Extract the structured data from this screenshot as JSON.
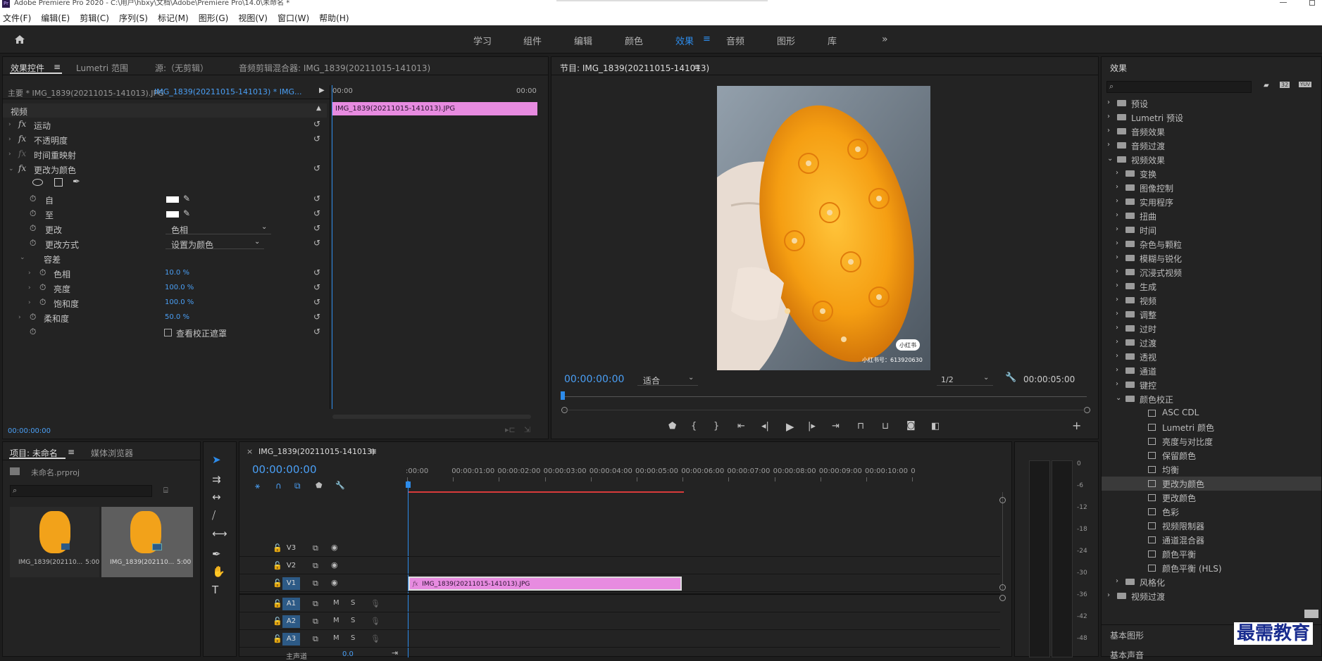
{
  "window": {
    "title": "Adobe Premiere Pro 2020 - C:\\用户\\hbxy\\文档\\Adobe\\Premiere Pro\\14.0\\未命名 *",
    "app_badge": "Pr"
  },
  "menu": [
    "文件(F)",
    "编辑(E)",
    "剪辑(C)",
    "序列(S)",
    "标记(M)",
    "图形(G)",
    "视图(V)",
    "窗口(W)",
    "帮助(H)"
  ],
  "workspaces": {
    "home_icon": "home-icon",
    "items": [
      "学习",
      "组件",
      "编辑",
      "颜色",
      "效果",
      "音频",
      "图形",
      "库"
    ],
    "active": "效果",
    "more": "»"
  },
  "effect_controls": {
    "tabs": [
      "效果控件",
      "Lumetri 范围",
      "源:（无剪辑）",
      "音频剪辑混合器: IMG_1839(20211015-141013)"
    ],
    "master": "主要 * IMG_1839(20211015-141013).JPG",
    "clip_ref": "IMG_1839(20211015-141013) * IMG...",
    "section": "视频",
    "effects": [
      "运动",
      "不透明度",
      "时间重映射",
      "更改为颜色"
    ],
    "params": {
      "from": "自",
      "to": "至",
      "change": "更改",
      "change_value": "色相",
      "change_by": "更改方式",
      "change_by_value": "设置为颜色",
      "tolerance": "容差",
      "hue": "色相",
      "hue_value": "10.0 %",
      "lightness": "亮度",
      "lightness_value": "100.0 %",
      "saturation": "饱和度",
      "saturation_value": "100.0 %",
      "softness": "柔和度",
      "softness_value": "50.0 %",
      "view_mask": "查看校正遮罩"
    },
    "timeline_start": "00:00",
    "timeline_end": "00:00",
    "clip_label": "IMG_1839(20211015-141013).JPG",
    "timecode": "00:00:00:00"
  },
  "program": {
    "title": "节目: IMG_1839(20211015-141013)",
    "timecode": "00:00:00:00",
    "fit": "适合",
    "quality": "1/2",
    "duration": "00:00:05:00",
    "watermark_badge": "小红书",
    "watermark_id": "小红书号：613920630"
  },
  "effects_panel": {
    "title": "效果",
    "tree": [
      {
        "label": "预设",
        "level": 0,
        "type": "star"
      },
      {
        "label": "Lumetri 预设",
        "level": 0,
        "type": "star"
      },
      {
        "label": "音频效果",
        "level": 0,
        "type": "folder"
      },
      {
        "label": "音频过渡",
        "level": 0,
        "type": "folder"
      },
      {
        "label": "视频效果",
        "level": 0,
        "type": "folder",
        "open": true
      },
      {
        "label": "变换",
        "level": 1,
        "type": "folder"
      },
      {
        "label": "图像控制",
        "level": 1,
        "type": "folder"
      },
      {
        "label": "实用程序",
        "level": 1,
        "type": "folder"
      },
      {
        "label": "扭曲",
        "level": 1,
        "type": "folder"
      },
      {
        "label": "时间",
        "level": 1,
        "type": "folder"
      },
      {
        "label": "杂色与颗粒",
        "level": 1,
        "type": "folder"
      },
      {
        "label": "模糊与锐化",
        "level": 1,
        "type": "folder"
      },
      {
        "label": "沉浸式视频",
        "level": 1,
        "type": "folder"
      },
      {
        "label": "生成",
        "level": 1,
        "type": "folder"
      },
      {
        "label": "视频",
        "level": 1,
        "type": "folder"
      },
      {
        "label": "调整",
        "level": 1,
        "type": "folder"
      },
      {
        "label": "过时",
        "level": 1,
        "type": "folder"
      },
      {
        "label": "过渡",
        "level": 1,
        "type": "folder"
      },
      {
        "label": "透视",
        "level": 1,
        "type": "folder"
      },
      {
        "label": "通道",
        "level": 1,
        "type": "folder"
      },
      {
        "label": "键控",
        "level": 1,
        "type": "folder"
      },
      {
        "label": "颜色校正",
        "level": 1,
        "type": "folder",
        "open": true
      },
      {
        "label": "ASC CDL",
        "level": 2,
        "type": "bin"
      },
      {
        "label": "Lumetri 颜色",
        "level": 2,
        "type": "bin"
      },
      {
        "label": "亮度与对比度",
        "level": 2,
        "type": "bin"
      },
      {
        "label": "保留颜色",
        "level": 2,
        "type": "bin"
      },
      {
        "label": "均衡",
        "level": 2,
        "type": "bin"
      },
      {
        "label": "更改为颜色",
        "level": 2,
        "type": "bin",
        "selected": true
      },
      {
        "label": "更改颜色",
        "level": 2,
        "type": "bin"
      },
      {
        "label": "色彩",
        "level": 2,
        "type": "bin"
      },
      {
        "label": "视频限制器",
        "level": 2,
        "type": "bin"
      },
      {
        "label": "通道混合器",
        "level": 2,
        "type": "bin"
      },
      {
        "label": "颜色平衡",
        "level": 2,
        "type": "bin"
      },
      {
        "label": "颜色平衡 (HLS)",
        "level": 2,
        "type": "bin"
      },
      {
        "label": "风格化",
        "level": 1,
        "type": "folder"
      },
      {
        "label": "视频过渡",
        "level": 0,
        "type": "folder"
      }
    ],
    "bottom": [
      "基本图形",
      "基本声音"
    ],
    "filter_badges": [
      "32",
      "YUV"
    ]
  },
  "project": {
    "tabs": [
      "项目: 未命名",
      "媒体浏览器"
    ],
    "file": "未命名.prproj",
    "items": [
      {
        "name": "IMG_1839(202110...",
        "dur": "5:00"
      },
      {
        "name": "IMG_1839(202110...",
        "dur": "5:00"
      }
    ]
  },
  "timeline": {
    "tab": "IMG_1839(20211015-141013)",
    "timecode": "00:00:00:00",
    "ruler": [
      ":00:00",
      "00:00:01:00",
      "00:00:02:00",
      "00:00:03:00",
      "00:00:04:00",
      "00:00:05:00",
      "00:00:06:00",
      "00:00:07:00",
      "00:00:08:00",
      "00:00:09:00",
      "00:00:10:00",
      "0"
    ],
    "video_tracks": [
      "V3",
      "V2",
      "V1"
    ],
    "audio_tracks": [
      "A1",
      "A2",
      "A3"
    ],
    "mute": "M",
    "solo": "S",
    "clip_label": "IMG_1839(20211015-141013).JPG",
    "master": "主声道",
    "master_value": "0.0"
  },
  "meter": {
    "labels": [
      "0",
      "-6",
      "-12",
      "-18",
      "-24",
      "-30",
      "-36",
      "-42",
      "-48"
    ]
  },
  "brand": "最需教育"
}
